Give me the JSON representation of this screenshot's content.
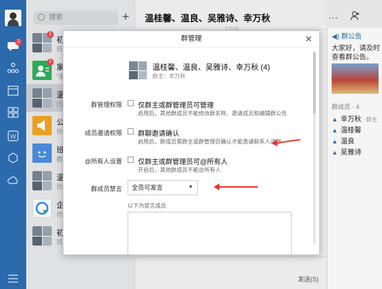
{
  "nav": {
    "chat_badge": "2",
    "icons": [
      "avatar",
      "message-icon",
      "contacts-icon",
      "calendar-icon",
      "grid-icon",
      "document-icon",
      "cube-icon",
      "cloud-icon",
      "menu-icon"
    ]
  },
  "chat_list": {
    "search_placeholder": "搜索",
    "add_icon": "plus-icon",
    "items": [
      {
        "name": "初",
        "preview": "班",
        "badge": "1"
      },
      {
        "name": "家",
        "preview": "“家",
        "badge": "1"
      },
      {
        "name": "温",
        "preview": "[你"
      },
      {
        "name": "公",
        "preview": "你"
      },
      {
        "name": "班",
        "preview": "教"
      },
      {
        "name": "温",
        "preview": "你"
      },
      {
        "name": "企",
        "preview": "你"
      },
      {
        "name": "初",
        "preview": "班"
      }
    ]
  },
  "main": {
    "title": "温桂馨、温良、吴雅诗、幸万秋",
    "date_fragment": "17/16",
    "send_label": "发送(S)"
  },
  "right_panel": {
    "notice_title": "群公告",
    "notice_text": "大家好，请及时查看群公告。",
    "members_header": "群成员 · 4",
    "members": [
      {
        "name": "幸万秋",
        "tag": "· 群主"
      },
      {
        "name": "温桂馨",
        "tag": ""
      },
      {
        "name": "温良",
        "tag": ""
      },
      {
        "name": "吴雅诗",
        "tag": ""
      }
    ]
  },
  "dialog": {
    "title": "群管理",
    "group_name": "温桂馨、温良、吴雅诗、幸万秋 (4)",
    "group_owner": "群主：幸万秋",
    "perm_label": "群管理权限",
    "perm_option": "仅群主或群管理员可管理",
    "perm_desc": "启用后，其他群成员不能修改群名称、邀请成员和编辑群公告",
    "invite_label": "成员邀请权限",
    "invite_option": "群聊邀请确认",
    "invite_desc": "启用后，群成员需群主或群管理员确认才能邀请联系人进群",
    "at_label": "@所有人设置",
    "at_option": "仅群主或群管理员可@所有人",
    "at_desc": "开启后，其他群成员不能@所有人",
    "mute_label": "群成员禁言",
    "mute_select": "全员可发言",
    "muted_header": "以下为禁言成员"
  },
  "colors": {
    "rail": "#2d6fb5",
    "accent": "#2d6fb5",
    "arrow": "#e8322b",
    "badge": "#f04a4a"
  }
}
